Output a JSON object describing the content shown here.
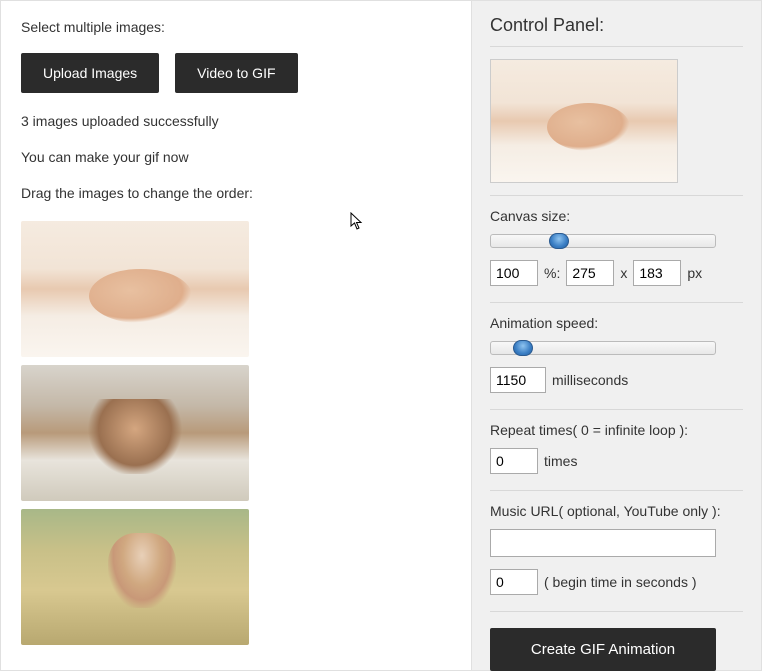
{
  "left": {
    "select_label": "Select multiple images:",
    "upload_button": "Upload Images",
    "video_button": "Video to GIF",
    "upload_status": "3 images uploaded successfully",
    "make_gif_msg": "You can make your gif now",
    "drag_msg": "Drag the images to change the order:"
  },
  "panel": {
    "title": "Control Panel:",
    "canvas_label": "Canvas size:",
    "canvas_percent": "100",
    "canvas_width": "275",
    "canvas_height": "183",
    "percent_sep": "%:",
    "x_sep": "x",
    "px_label": "px",
    "speed_label": "Animation speed:",
    "speed_value": "1150",
    "speed_unit": "milliseconds",
    "repeat_label": "Repeat times( 0 = infinite loop ):",
    "repeat_value": "0",
    "repeat_unit": "times",
    "music_label": "Music URL( optional, YouTube only ):",
    "music_url": "",
    "music_begin": "0",
    "music_begin_unit": "( begin time in seconds )",
    "create_button": "Create GIF Animation"
  }
}
